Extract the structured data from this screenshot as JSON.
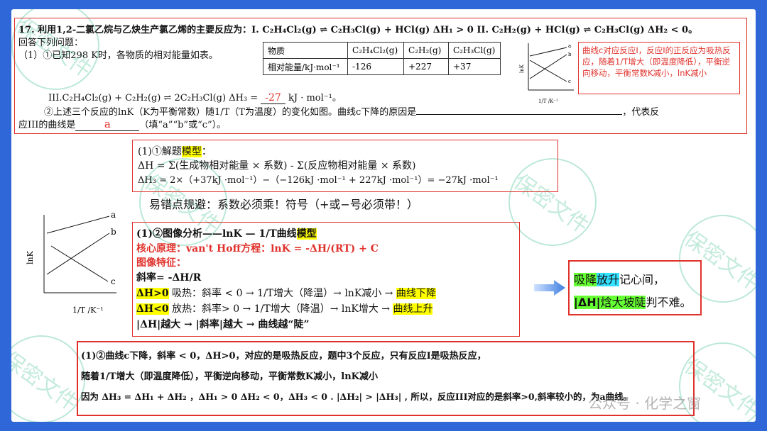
{
  "question": {
    "line1": "17. 利用1,2-二氯乙烷与乙炔生产氯乙烯的主要反应为：I. C₂H₄Cl₂(g) ⇌ C₂H₃Cl(g) + HCl(g)  ΔH₁ > 0   II. C₂H₂(g) + HCl(g) ⇌ C₂H₃Cl(g)  ΔH₂ < 0。",
    "line2": "回答下列问题：",
    "line3": "（1）①已知298 K时，各物质的相对能量如表。",
    "reaction3": "III.C₂H₄Cl₂(g) + C₂H₂(g) ⇌ 2C₂H₃Cl(g)  ΔH₃ =",
    "answer_dh3": "-27",
    "unit": "kJ · mol⁻¹。",
    "line5_a": "②上述三个反应的lnK（K为平衡常数）随1/T（T为温度）的变化如图。曲线c下降的原因是",
    "line5_b": "，代表反",
    "line6_a": "应III的曲线是",
    "answer_curve": "a",
    "line6_b": "（填“a”“b”或“c”）。"
  },
  "energy_table": {
    "headers": [
      "物质",
      "C₂H₄Cl₂(g)",
      "C₂H₂(g)",
      "C₂H₃Cl(g)"
    ],
    "row_label": "相对能量/kJ·mol⁻¹",
    "values": [
      "-126",
      "+227",
      "+37"
    ]
  },
  "side_note": "曲线c对应反应I，反应I的正反应为吸热反应，随着1/T增大（即温度降低），平衡逆向移动，平衡常数K减小，lnK减小",
  "small_graph": {
    "ylabel": "lnK",
    "xlabel": "1/T /K⁻¹",
    "curves": [
      "a",
      "b",
      "c"
    ]
  },
  "box_model": {
    "title_prefix": "(1)①解题",
    "title_hl": "模型",
    "title_suffix": "：",
    "formula": "ΔH = Σ(生成物相对能量 × 系数) - Σ(反应物相对能量 × 系数)",
    "calc": "ΔH₃ = 2×（+37kJ ·mol⁻¹）−（−126kJ ·mol⁻¹ + 227kJ ·mol⁻¹）= −27kJ ·mol⁻¹"
  },
  "tip": "易错点规避：系数必须乘！符号（+或−号必须带！）",
  "graph_big": {
    "ylabel": "lnK",
    "xlabel": "1/T /K⁻¹",
    "curves": [
      "a",
      "b",
      "c"
    ]
  },
  "box_analysis": {
    "title_prefix": "(1)②图像分析——lnK — 1/T曲线",
    "title_hl": "模型",
    "principle": "核心原理：van't Hoff方程：lnK = -ΔH/(RT) + C",
    "features": "图像特征：",
    "slope": "斜率= -ΔH/R",
    "row1_a": "ΔH>0",
    "row1_b": " 吸热：斜率 < 0 → 1/T增大（降温）→ lnK减小 → ",
    "row1_c": "曲线下降",
    "row2_a": "ΔH<0",
    "row2_b": " 放热：斜率> 0  → 1/T增大（降温）→ lnK增大 →  ",
    "row2_c": "曲线上升",
    "row3": " |ΔH|越大 → |斜率|越大 → 曲线越“陡”"
  },
  "mnemonic": {
    "l1_a": "吸降",
    "l1_b": "放升",
    "l1_c": "记心间，",
    "l2_a": "|ΔH|",
    "l2_b": "焓大坡陡",
    "l2_c": "判不难。"
  },
  "box_answer": {
    "line1": "(1)②曲线c下降，斜率 < 0，ΔH>0，对应的是吸热反应，题中3个反应，只有反应I是吸热反应，",
    "line2": "随着1/T增大（即温度降低），平衡逆向移动，平衡常数K减小，lnK减小",
    "line3": "因为 ΔH₃ = ΔH₁ + ΔH₂ ，ΔH₁ > 0   ΔH₂ < 0，ΔH₃ < 0 . |ΔH₂| > |ΔH₃| , 所以，反应III对应的是斜率>0,斜率较小的，为a曲线。"
  },
  "watermark": {
    "wm_text": "保密文件",
    "source": "公众号 · 化学之窗"
  },
  "colors": {
    "background": "#2f67d8",
    "accent_red": "#e0322c",
    "highlight_yellow": "#ffff00",
    "highlight_green": "#66ff33",
    "highlight_cyan": "#33e0ff"
  }
}
